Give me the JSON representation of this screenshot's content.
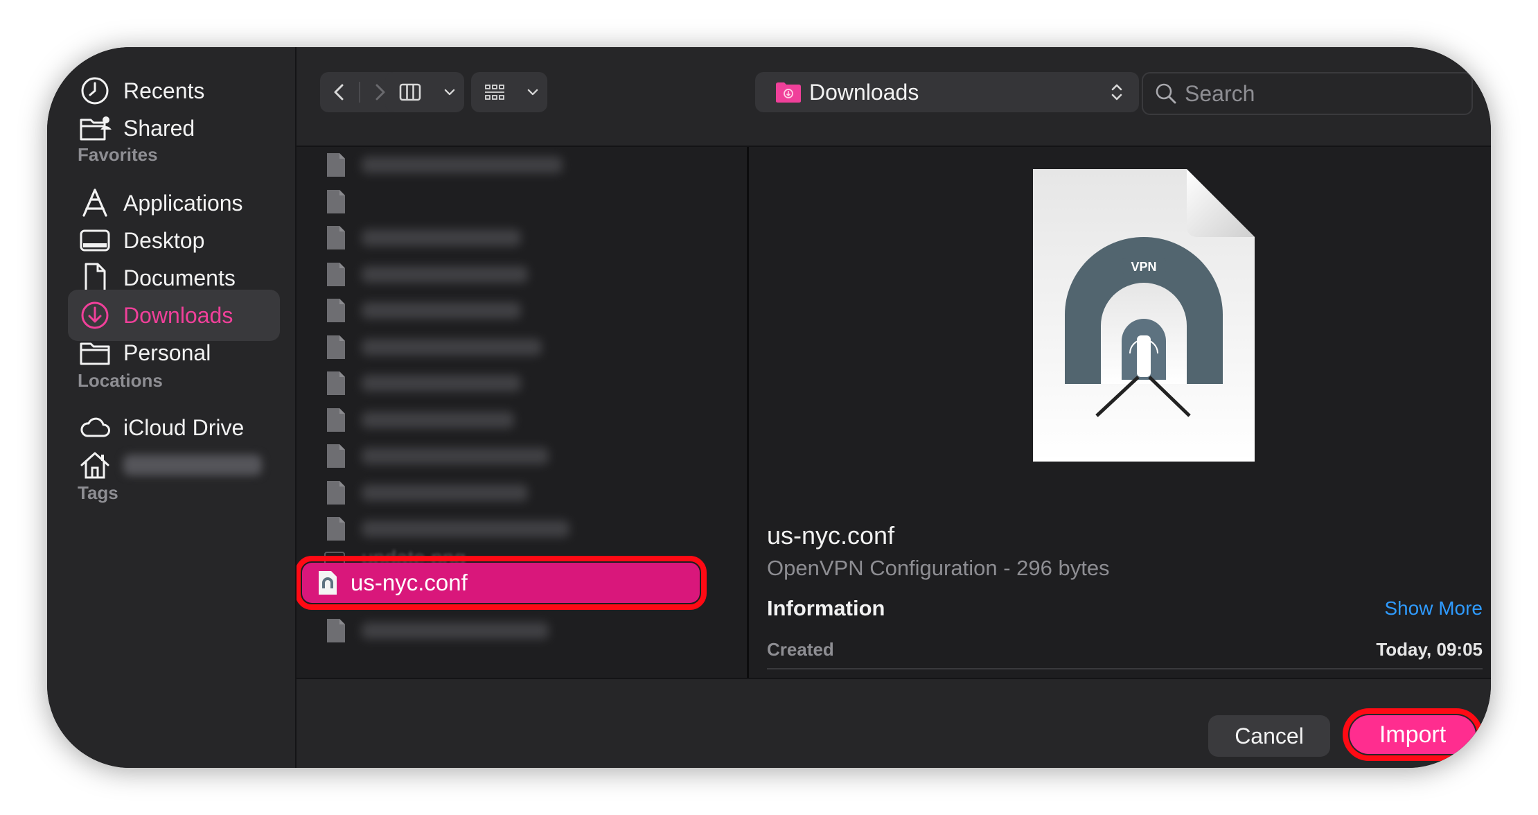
{
  "sidebar": {
    "items": [
      {
        "label": "Recents",
        "icon": "clock-icon"
      },
      {
        "label": "Shared",
        "icon": "shared-folder-icon"
      }
    ],
    "favorites_title": "Favorites",
    "favorites": [
      {
        "label": "Applications",
        "icon": "applications-icon"
      },
      {
        "label": "Desktop",
        "icon": "desktop-icon"
      },
      {
        "label": "Documents",
        "icon": "document-icon"
      },
      {
        "label": "Downloads",
        "icon": "download-icon",
        "active": true
      },
      {
        "label": "Personal",
        "icon": "folder-icon"
      }
    ],
    "locations_title": "Locations",
    "locations": [
      {
        "label": "iCloud Drive",
        "icon": "cloud-icon"
      },
      {
        "label": "",
        "icon": "home-icon",
        "blurred": true
      }
    ],
    "tags_title": "Tags"
  },
  "toolbar": {
    "location": "Downloads",
    "search_placeholder": "Search"
  },
  "files": {
    "visible_name": "update.png",
    "selected": "us-nyc.conf"
  },
  "preview": {
    "filename": "us-nyc.conf",
    "subtitle": "OpenVPN Configuration - 296 bytes",
    "info_title": "Information",
    "show_more": "Show More",
    "created_label": "Created",
    "created_value": "Today, 09:05",
    "badge": "VPN"
  },
  "buttons": {
    "cancel": "Cancel",
    "import": "Import"
  },
  "colors": {
    "accent": "#f0409a",
    "selection": "#d9177b",
    "import_button": "#ff2d8f",
    "highlight_outline": "#ff0a14",
    "link": "#2f9bff"
  }
}
